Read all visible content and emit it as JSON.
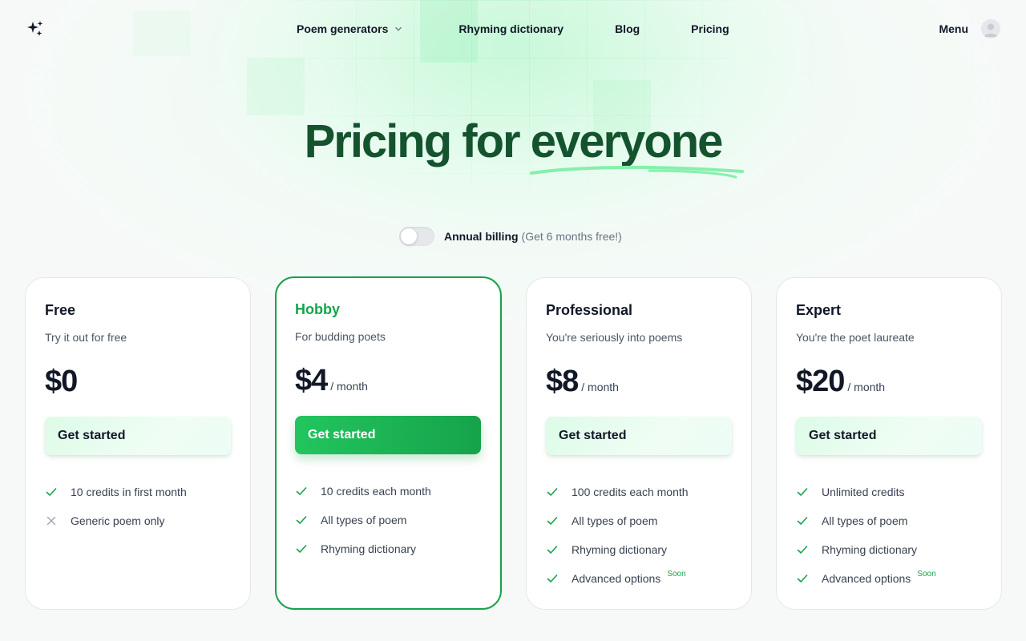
{
  "nav": {
    "links": [
      {
        "label": "Poem generators"
      },
      {
        "label": "Rhyming dictionary"
      },
      {
        "label": "Blog"
      },
      {
        "label": "Pricing"
      }
    ],
    "menu_label": "Menu"
  },
  "hero": {
    "title_start": "Pricing for",
    "title_accent": "everyone"
  },
  "billing": {
    "label": "Annual billing",
    "note": "(Get 6 months free!)",
    "enabled": false
  },
  "plans": [
    {
      "name": "Free",
      "description": "Try it out for free",
      "price": "$0",
      "period": "",
      "cta": "Get started",
      "features": [
        {
          "text": "10 credits in first month",
          "included": true,
          "badge": ""
        },
        {
          "text": "Generic poem only",
          "included": false,
          "badge": ""
        }
      ]
    },
    {
      "name": "Hobby",
      "description": "For budding poets",
      "price": "$4",
      "period": "/ month",
      "cta": "Get started",
      "featured": true,
      "features": [
        {
          "text": "10 credits each month",
          "included": true,
          "badge": ""
        },
        {
          "text": "All types of poem",
          "included": true,
          "badge": ""
        },
        {
          "text": "Rhyming dictionary",
          "included": true,
          "badge": ""
        }
      ]
    },
    {
      "name": "Professional",
      "description": "You're seriously into poems",
      "price": "$8",
      "period": "/ month",
      "cta": "Get started",
      "features": [
        {
          "text": "100 credits each month",
          "included": true,
          "badge": ""
        },
        {
          "text": "All types of poem",
          "included": true,
          "badge": ""
        },
        {
          "text": "Rhyming dictionary",
          "included": true,
          "badge": ""
        },
        {
          "text": "Advanced options",
          "included": true,
          "badge": "Soon"
        }
      ]
    },
    {
      "name": "Expert",
      "description": "You're the poet laureate",
      "price": "$20",
      "period": "/ month",
      "cta": "Get started",
      "features": [
        {
          "text": "Unlimited credits",
          "included": true,
          "badge": ""
        },
        {
          "text": "All types of poem",
          "included": true,
          "badge": ""
        },
        {
          "text": "Rhyming dictionary",
          "included": true,
          "badge": ""
        },
        {
          "text": "Advanced options",
          "included": true,
          "badge": "Soon"
        }
      ]
    }
  ],
  "colors": {
    "brand_green": "#16a34a",
    "title_green": "#14532d",
    "underline_green": "#86efac",
    "cross_gray": "#9ca3af"
  }
}
